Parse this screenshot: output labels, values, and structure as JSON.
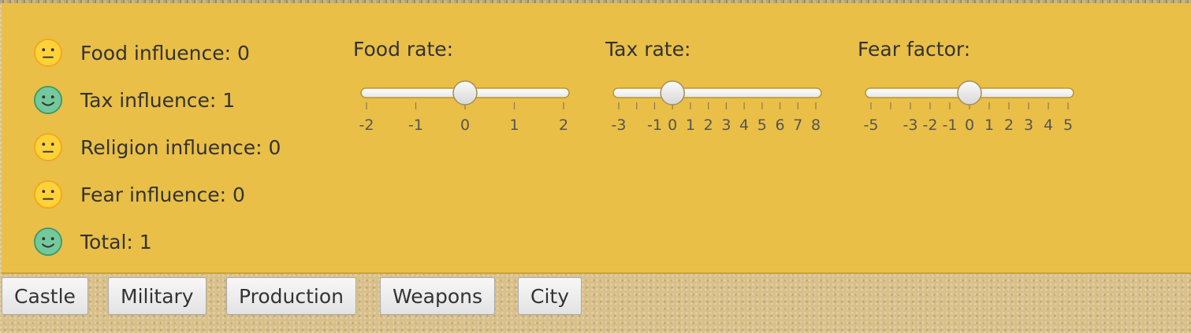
{
  "influences": [
    {
      "label": "Food influence: 0",
      "mood": "neutral-face-icon"
    },
    {
      "label": "Tax influence: 1",
      "mood": "happy-face-icon"
    },
    {
      "label": "Religion influence: 0",
      "mood": "neutral-face-icon"
    },
    {
      "label": "Fear influence: 0",
      "mood": "neutral-face-icon"
    },
    {
      "label": "Total: 1",
      "mood": "happy-face-icon"
    }
  ],
  "sliders": [
    {
      "title": "Food rate:",
      "min": -2,
      "max": 2,
      "value": 0,
      "tick_labels": [
        "-2",
        "-1",
        "0",
        "1",
        "2"
      ],
      "minor_ticks": 0
    },
    {
      "title": "Tax rate:",
      "min": -3,
      "max": 8,
      "value": 0,
      "tick_labels": [
        "-3",
        "",
        "-1",
        "0",
        "1",
        "2",
        "3",
        "4",
        "5",
        "6",
        "7",
        "8"
      ],
      "minor_ticks": 0
    },
    {
      "title": "Fear factor:",
      "min": -5,
      "max": 5,
      "value": 0,
      "tick_labels": [
        "-5",
        "",
        "-3",
        "-2",
        "-1",
        "0",
        "1",
        "2",
        "3",
        "4",
        "5"
      ],
      "minor_ticks": 0
    }
  ],
  "tabs": [
    "Castle",
    "Military",
    "Production",
    "Weapons",
    "City"
  ],
  "colors": {
    "panel": "#e9bf47",
    "neutral_face": "#ffd23a",
    "happy_face": "#74c99c"
  }
}
